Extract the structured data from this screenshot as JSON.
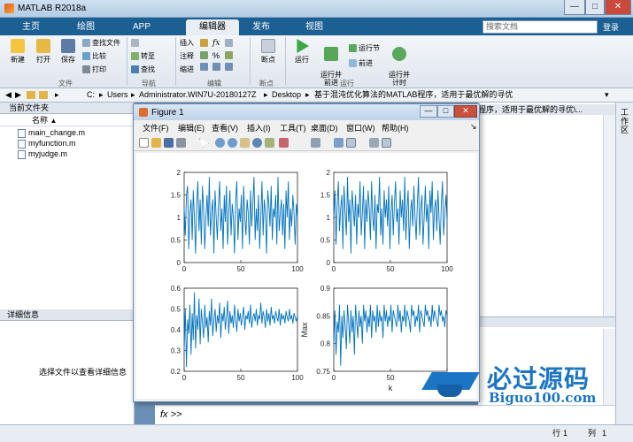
{
  "window": {
    "title": "MATLAB R2018a",
    "min": "—",
    "max": "□",
    "close": "✕"
  },
  "tabs": [
    "主页",
    "绘图",
    "APP",
    "编辑器",
    "发布",
    "视图"
  ],
  "search": {
    "placeholder": "搜索文档",
    "login": "登录"
  },
  "toolstrip": {
    "new": "新建",
    "open": "打开",
    "save": "保存",
    "find_files": "查找文件",
    "compare": "比较",
    "print": "打印",
    "insert": "插入",
    "comment": "注释",
    "indent": "缩进",
    "goto": "转至",
    "find": "查找",
    "breakpoints": "断点",
    "run": "运行",
    "run_advance": "运行并\n前进",
    "run_section": "运行节",
    "advance": "前进",
    "run_time": "运行并\n计时",
    "group_file": "文件",
    "group_nav": "导航",
    "group_edit": "编辑",
    "group_bp": "断点",
    "group_run": "运行"
  },
  "address": {
    "path": [
      "C:",
      "Users",
      "Administrator.WIN7U-20180127Z",
      "Desktop",
      "基于混沌优化算法的MATLAB程序，适用于最优解的寻优"
    ]
  },
  "left_panel": {
    "title": "当前文件夹",
    "col_name": "名称",
    "files": [
      "main_change.m",
      "myfunction.m",
      "myjudge.m"
    ],
    "details_title": "详细信息",
    "details_msg": "选择文件以查看详细信息"
  },
  "right_panel": {
    "tab_text": "程序，适用于最优解的寻优\\...",
    "side_label": "工作区"
  },
  "command": {
    "prompt": "fx >>"
  },
  "status": {
    "row_label": "行",
    "row": "1",
    "col_label": "列",
    "col": "1"
  },
  "figure": {
    "title": "Figure 1",
    "menu": [
      "文件(F)",
      "编辑(E)",
      "查看(V)",
      "插入(I)",
      "工具(T)",
      "桌面(D)",
      "窗口(W)",
      "帮助(H)"
    ]
  },
  "watermark": {
    "text": "必过源码",
    "url": "Biguo100.com"
  },
  "chart_data": [
    {
      "type": "line",
      "xlim": [
        0,
        100
      ],
      "ylim": [
        0,
        2
      ],
      "xticks": [
        "0",
        "50",
        "100"
      ],
      "yticks": [
        "0",
        "0.5",
        "1",
        "1.5",
        "2"
      ],
      "values": [
        1.2,
        0.6,
        1.5,
        1.7,
        0.3,
        1.1,
        1.4,
        0.5,
        1.6,
        1.0,
        0.2,
        1.3,
        1.8,
        0.7,
        1.4,
        0.4,
        1.7,
        1.2,
        0.3,
        1.0,
        1.5,
        0.8,
        1.9,
        0.6,
        1.1,
        1.4,
        0.2,
        1.6,
        1.0,
        0.5,
        1.3,
        1.8,
        0.7,
        1.2,
        0.3,
        1.5,
        0.9,
        1.7,
        0.4,
        1.1,
        1.6,
        0.6,
        1.3,
        1.0,
        0.2,
        1.4,
        1.8,
        0.5,
        1.2,
        0.9,
        1.5,
        0.3,
        1.7,
        1.0,
        0.6,
        1.4,
        1.1,
        0.4,
        1.6,
        0.8,
        1.3,
        1.9,
        0.5,
        1.2,
        0.7,
        1.5,
        0.3,
        1.0,
        1.8,
        0.6,
        1.4,
        1.1,
        0.2,
        1.6,
        1.3,
        0.8,
        1.7,
        0.5,
        1.2,
        1.0,
        1.5,
        0.4,
        1.9,
        0.7,
        1.1,
        1.4,
        0.6,
        1.3,
        0.3,
        1.6,
        1.0,
        1.8,
        0.5,
        1.2,
        0.8,
        1.5,
        1.1,
        0.4,
        1.3,
        1.0
      ]
    },
    {
      "type": "line",
      "xlim": [
        0,
        100
      ],
      "ylim": [
        0,
        2
      ],
      "xticks": [
        "0",
        "50",
        "100"
      ],
      "yticks": [
        "0",
        "0.5",
        "1",
        "1.5",
        "2"
      ],
      "values": [
        1.0,
        1.6,
        0.4,
        1.3,
        1.8,
        0.7,
        1.2,
        1.5,
        0.3,
        1.7,
        1.1,
        0.6,
        1.9,
        0.9,
        1.4,
        0.2,
        1.6,
        1.2,
        0.8,
        1.5,
        0.4,
        1.3,
        1.0,
        1.8,
        0.6,
        1.1,
        1.7,
        0.3,
        1.4,
        0.9,
        1.6,
        1.2,
        0.5,
        1.8,
        1.0,
        0.7,
        1.5,
        0.3,
        1.3,
        1.1,
        1.9,
        0.6,
        1.2,
        0.4,
        1.6,
        1.0,
        1.4,
        0.8,
        1.7,
        0.3,
        1.1,
        1.5,
        0.6,
        1.3,
        1.8,
        0.9,
        1.2,
        0.4,
        1.6,
        1.0,
        1.4,
        0.7,
        1.9,
        0.5,
        1.2,
        1.6,
        0.3,
        1.1,
        1.4,
        0.8,
        1.7,
        1.0,
        0.5,
        1.3,
        1.9,
        0.6,
        1.2,
        1.5,
        0.4,
        1.0,
        1.7,
        0.9,
        1.3,
        0.3,
        1.6,
        1.1,
        1.8,
        0.5,
        1.2,
        1.4,
        0.7,
        1.6,
        1.0,
        0.4,
        1.3,
        1.8,
        0.6,
        1.1,
        1.5,
        0.9
      ]
    },
    {
      "type": "line",
      "xlim": [
        0,
        100
      ],
      "ylim": [
        0.2,
        0.6
      ],
      "xticks": [
        "0",
        "50",
        "100"
      ],
      "yticks": [
        "0.2",
        "0.3",
        "0.4",
        "0.5",
        "0.6"
      ],
      "values": [
        0.3,
        0.5,
        0.22,
        0.45,
        0.38,
        0.52,
        0.28,
        0.48,
        0.35,
        0.58,
        0.31,
        0.47,
        0.4,
        0.55,
        0.33,
        0.5,
        0.43,
        0.36,
        0.52,
        0.41,
        0.46,
        0.34,
        0.49,
        0.42,
        0.55,
        0.37,
        0.45,
        0.5,
        0.39,
        0.47,
        0.43,
        0.53,
        0.36,
        0.48,
        0.44,
        0.51,
        0.4,
        0.46,
        0.54,
        0.38,
        0.49,
        0.43,
        0.47,
        0.41,
        0.52,
        0.45,
        0.39,
        0.5,
        0.44,
        0.48,
        0.42,
        0.46,
        0.51,
        0.4,
        0.47,
        0.45,
        0.49,
        0.43,
        0.52,
        0.41,
        0.46,
        0.48,
        0.44,
        0.5,
        0.42,
        0.47,
        0.45,
        0.53,
        0.43,
        0.49,
        0.46,
        0.41,
        0.5,
        0.44,
        0.48,
        0.42,
        0.51,
        0.45,
        0.47,
        0.43,
        0.49,
        0.46,
        0.44,
        0.5,
        0.42,
        0.48,
        0.45,
        0.47,
        0.43,
        0.49,
        0.46,
        0.44,
        0.5,
        0.45,
        0.47,
        0.43,
        0.48,
        0.46,
        0.44,
        0.47
      ]
    },
    {
      "type": "line",
      "xlim": [
        0,
        100
      ],
      "ylim": [
        0.75,
        0.9
      ],
      "xlabel": "k",
      "ylabel": "Max",
      "xticks": [
        "0",
        "50",
        "100"
      ],
      "yticks": [
        "0.75",
        "0.8",
        "0.85",
        "0.9"
      ],
      "values": [
        0.8,
        0.86,
        0.78,
        0.84,
        0.82,
        0.87,
        0.76,
        0.85,
        0.81,
        0.86,
        0.83,
        0.79,
        0.87,
        0.84,
        0.8,
        0.86,
        0.82,
        0.85,
        0.78,
        0.87,
        0.84,
        0.81,
        0.86,
        0.83,
        0.85,
        0.8,
        0.87,
        0.84,
        0.86,
        0.82,
        0.85,
        0.83,
        0.87,
        0.81,
        0.86,
        0.84,
        0.85,
        0.82,
        0.87,
        0.83,
        0.86,
        0.84,
        0.85,
        0.81,
        0.87,
        0.84,
        0.86,
        0.83,
        0.85,
        0.84,
        0.87,
        0.82,
        0.86,
        0.85,
        0.84,
        0.83,
        0.87,
        0.84,
        0.86,
        0.82,
        0.85,
        0.84,
        0.87,
        0.83,
        0.86,
        0.85,
        0.84,
        0.82,
        0.87,
        0.85,
        0.86,
        0.83,
        0.85,
        0.84,
        0.87,
        0.82,
        0.86,
        0.85,
        0.84,
        0.83,
        0.87,
        0.85,
        0.86,
        0.84,
        0.85,
        0.83,
        0.87,
        0.84,
        0.86,
        0.85,
        0.84,
        0.83,
        0.87,
        0.85,
        0.86,
        0.84,
        0.85,
        0.83,
        0.86,
        0.85
      ]
    }
  ]
}
